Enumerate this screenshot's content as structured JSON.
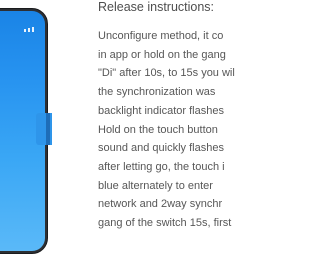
{
  "instructions": {
    "title": "Release instructions:",
    "lines": [
      "Unconfigure method, it co",
      "in app or hold on the gang",
      "\"Di\" after 10s, to 15s you wil",
      "the synchronization was",
      "backlight indicator flashes",
      "Hold on the touch button",
      "sound and quickly flashes",
      "after letting go, the touch i",
      "blue alternately to enter",
      "network and 2way synchr",
      "gang of the switch 15s, first"
    ]
  },
  "colors": {
    "screen_top": "#1a84e6",
    "screen_bottom": "#5ab9f8",
    "text": "#575757"
  }
}
